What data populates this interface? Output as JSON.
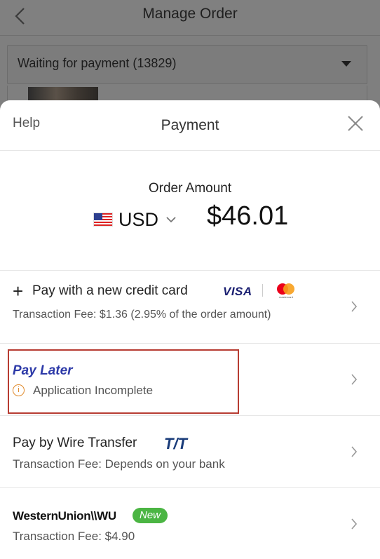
{
  "background": {
    "title": "Manage Order",
    "status_filter": "Waiting for payment (13829)"
  },
  "sheet": {
    "help": "Help",
    "title": "Payment",
    "amount_label": "Order Amount",
    "currency": "USD",
    "amount": "$46.01"
  },
  "methods": {
    "credit_card": {
      "title": "Pay with a new credit card",
      "visa": "VISA",
      "mastercard_text": "mastercard",
      "fee": "Transaction Fee: $1.36 (2.95% of the order amount)"
    },
    "pay_later": {
      "title": "Pay Later",
      "status": "Application Incomplete",
      "info_glyph": "i"
    },
    "wire": {
      "title": "Pay by Wire Transfer",
      "badge": "T/T",
      "fee": "Transaction Fee: Depends on your bank"
    },
    "western_union": {
      "logo": "WesternUnion\\\\WU",
      "badge": "New",
      "fee": "Transaction Fee: $4.90"
    }
  },
  "icons": {
    "back": "chevron-left-icon",
    "close": "close-icon",
    "dropdown": "caret-down-icon",
    "row_chevron": "chevron-right-icon"
  },
  "colors": {
    "pay_later_blue": "#2d3aa8",
    "highlight_border": "#b73c32",
    "new_badge": "#4bb543"
  }
}
